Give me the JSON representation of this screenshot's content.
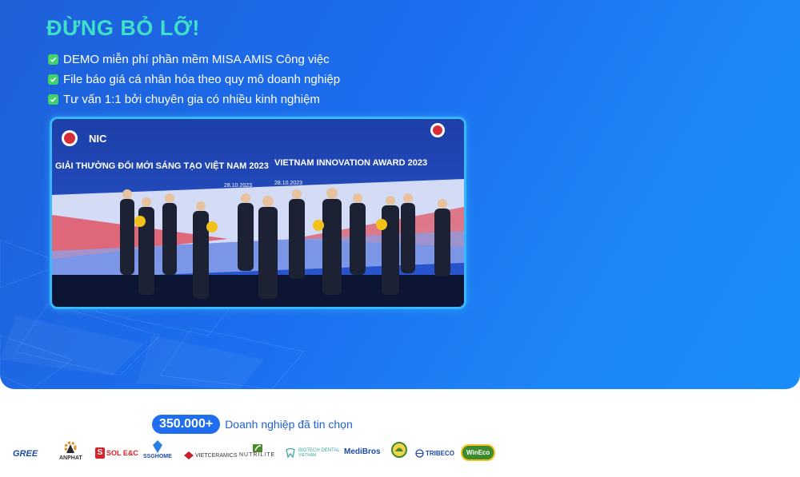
{
  "hero": {
    "headline": "ĐỪNG BỎ LỠ!",
    "benefits": [
      "DEMO miễn phí phần mềm MISA AMIS Công việc",
      "File báo giá cá nhân hóa theo quy mô doanh nghiệp",
      "Tư vấn 1:1 bởi chuyên gia có nhiều kinh nghiệm"
    ],
    "accent_color": "#3ee0c8",
    "check_color": "#40d36b"
  },
  "photo": {
    "banner_left": "GIẢI THƯỞNG ĐỔI MỚI SÁNG TẠO VIỆT NAM 2023",
    "banner_right": "VIETNAM INNOVATION AWARD 2023",
    "date_left": "28.10.2023",
    "date_right": "28.10.2023",
    "logo_mark": "NIC"
  },
  "stats": {
    "count": "350.000+",
    "label": "Doanh nghiệp đã tin chọn"
  },
  "logos": {
    "gree": "GREE",
    "anphat": "ANPHAT",
    "sol": "SOL E&C",
    "sshome": "SSGHOME",
    "vietceramics": "VIETCERAMICS",
    "nutrilite": "NUTRILITE",
    "biotech": "BIOTECH DENTAL",
    "biotech_sub": "VIETNAM",
    "medibros": "MediBros",
    "tribeco": "TRIBECO",
    "wineco": "WinEco"
  }
}
